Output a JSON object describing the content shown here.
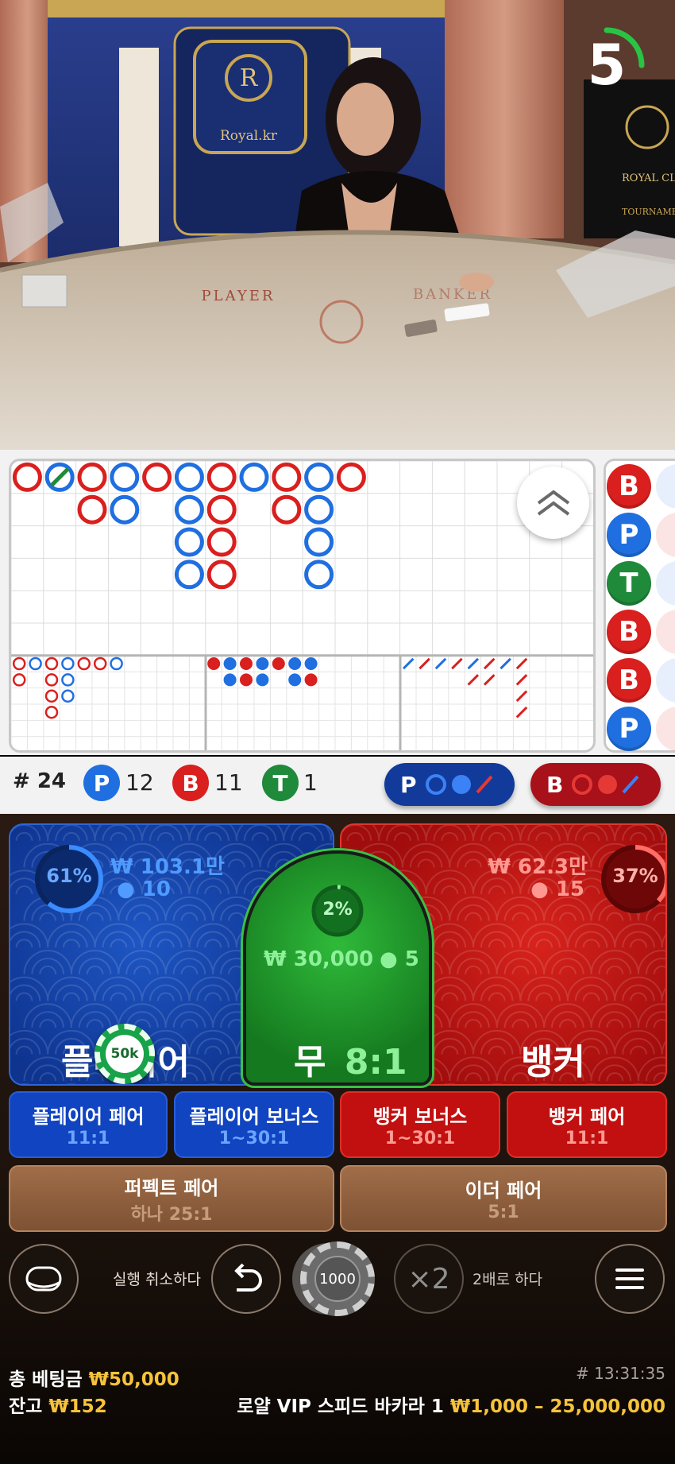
{
  "video": {
    "logo_text": "Royal.kr",
    "logo_letter": "R",
    "table_label_player": "PLAYER",
    "table_label_banker": "BANKER",
    "side_sign_line1": "ROYAL CLA",
    "side_sign_line2": "TOURNAMEN",
    "countdown": "5",
    "countdown_fraction": 0.25
  },
  "stats": {
    "round": "# 24",
    "player_letter": "P",
    "player_count": "12",
    "banker_letter": "B",
    "banker_count": "11",
    "tie_letter": "T",
    "tie_count": "1",
    "predict_player": "P",
    "predict_banker": "B"
  },
  "side_road": [
    "B",
    "P",
    "T",
    "B",
    "B",
    "P"
  ],
  "colors": {
    "player": "#1f6fe0",
    "banker": "#d9201e",
    "tie": "#1e8a3a",
    "gold": "#f6c33a"
  },
  "bets": {
    "player": {
      "title": "플레이어",
      "percent": "61%",
      "percent_value": 61,
      "amount": "₩ 103.1만",
      "players": "10"
    },
    "banker": {
      "title": "뱅커",
      "percent": "37%",
      "percent_value": 37,
      "amount": "₩ 62.3만",
      "players": "15"
    },
    "tie": {
      "title": "무",
      "odds": "8:1",
      "percent": "2%",
      "percent_value": 2,
      "amount": "₩ 30,000",
      "players": "5"
    },
    "chip_on_player": "50k"
  },
  "side_bets": [
    {
      "label": "플레이어 페어",
      "odds": "11:1"
    },
    {
      "label": "플레이어 보너스",
      "odds": "1~30:1"
    },
    {
      "label": "뱅커 보너스",
      "odds": "1~30:1"
    },
    {
      "label": "뱅커 페어",
      "odds": "11:1"
    },
    {
      "label": "퍼펙트 페어",
      "odds": "하나 25:1"
    },
    {
      "label": "이더 페어",
      "odds": "5:1"
    }
  ],
  "controls": {
    "undo_label": "실행 취소하다",
    "chip_value": "1000",
    "double_symbol": "×2",
    "double_label": "2배로 하다"
  },
  "footer": {
    "total_bet_label": "총 베팅금",
    "total_bet_value": "₩50,000",
    "balance_label": "잔고",
    "balance_value": "₩152",
    "round_id": "# 13:31:35",
    "table_name": "로얄 VIP 스피드 바카라 1",
    "limits": "₩1,000 – 25,000,000"
  }
}
